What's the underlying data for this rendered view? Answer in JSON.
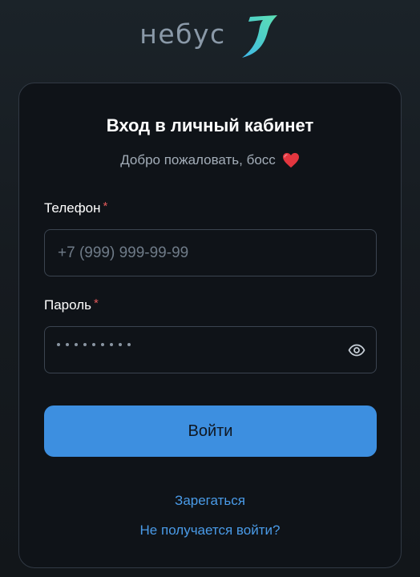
{
  "brand": {
    "name": "небус"
  },
  "login": {
    "title": "Вход в личный кабинет",
    "subtitle": "Добро пожаловать, босс",
    "subtitle_icon": "heart-icon"
  },
  "form": {
    "phone_label": "Телефон",
    "phone_required_mark": "*",
    "phone_value": "",
    "phone_placeholder": "+7 (999) 999-99-99",
    "password_label": "Пароль",
    "password_required_mark": "*",
    "password_mask_length": 9,
    "password_toggle_icon": "eye-icon",
    "submit_label": "Войти"
  },
  "links": {
    "register": "Зарегаться",
    "cant_login": "Не получается войти?"
  },
  "colors": {
    "accent": "#3d8fe0",
    "link": "#4a9be8",
    "required": "#e05a5a"
  }
}
